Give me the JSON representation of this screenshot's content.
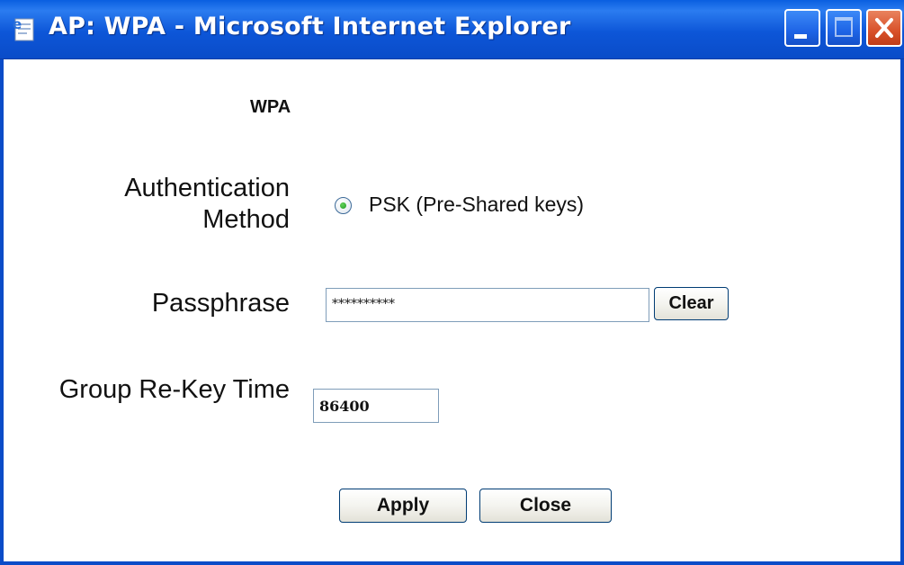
{
  "window": {
    "title": "AP: WPA - Microsoft Internet Explorer",
    "app_icon": "ie-page-icon",
    "controls": [
      "minimize-icon",
      "maximize-icon",
      "close-icon"
    ]
  },
  "form": {
    "section_title": "WPA",
    "auth_label": "Authentication Method",
    "auth_option": {
      "label": "PSK (Pre-Shared keys)",
      "selected": true
    },
    "passphrase_label": "Passphrase",
    "passphrase_value": "**********",
    "clear_label": "Clear",
    "rekey_label": "Group Re-Key Time",
    "rekey_value": "86400"
  },
  "actions": {
    "apply_label": "Apply",
    "close_label": "Close"
  },
  "colors": {
    "titlebar": "#0a4cc8",
    "close_button": "#d8512a",
    "radio_selected": "#1f9a22"
  }
}
